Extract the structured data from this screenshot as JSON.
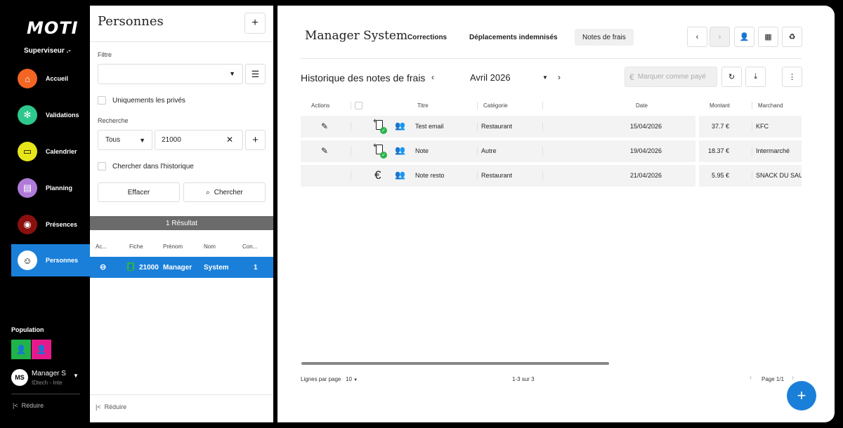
{
  "app": {
    "logo": "MOTI",
    "role": "Superviseur .-"
  },
  "sidebar": {
    "items": [
      {
        "label": "Accueil",
        "color": "#f26522",
        "icon": "home-icon",
        "glyph": "⌂"
      },
      {
        "label": "Validations",
        "color": "#2dc88c",
        "icon": "asterisk-icon",
        "glyph": "✻"
      },
      {
        "label": "Calendrier",
        "color": "#e6e61a",
        "icon": "calendar-icon",
        "glyph": "▭"
      },
      {
        "label": "Planning",
        "color": "#b07ad8",
        "icon": "planning-icon",
        "glyph": "▤"
      },
      {
        "label": "Présences",
        "color": "#8a1010",
        "icon": "eye-icon",
        "glyph": "◉"
      },
      {
        "label": "Personnes",
        "color": "#ffffff",
        "icon": "face-icon",
        "glyph": "☺"
      }
    ],
    "active_index": 5,
    "population_label": "Population",
    "population_colors": [
      "#1fb34a",
      "#e6198c"
    ],
    "user_initials": "MS",
    "user_name": "Manager S",
    "user_sub": "IDtech - Inte",
    "reduce_label": "Réduire"
  },
  "persons": {
    "title": "Personnes",
    "filter_label": "Filtre",
    "filter_value": "",
    "only_private_label": "Uniquements les privés",
    "search_label": "Recherche",
    "scope_value": "Tous",
    "search_value": "21000",
    "history_label": "Chercher dans l'historique",
    "clear_label": "Effacer",
    "search_button_label": "Chercher",
    "result_label": "1 Résultat",
    "columns": [
      "Ac...",
      "Fiche",
      "Prénom",
      "Nom",
      "Con..."
    ],
    "row": {
      "fiche": "21000",
      "prenom": "Manager",
      "nom": "System",
      "con": "1"
    },
    "reduce_label": "Réduire"
  },
  "main": {
    "title": "Manager System",
    "tabs": [
      "Corrections",
      "Déplacements indemnisés",
      "Notes de frais"
    ],
    "active_tab": 2,
    "history_title": "Historique des notes de frais",
    "month": "Avril 2026",
    "mark_paid_label": "Marquer comme payé",
    "columns": {
      "actions": "Actions",
      "titre": "Titre",
      "categorie": "Catégorie",
      "date": "Date",
      "montant": "Montant",
      "marchand": "Marchand"
    },
    "rows": [
      {
        "editable": true,
        "type": "doc",
        "titre": "Test email",
        "categorie": "Restaurant",
        "date": "15/04/2026",
        "montant": "37.7 €",
        "marchand": "KFC"
      },
      {
        "editable": true,
        "type": "doc",
        "titre": "Note",
        "categorie": "Autre",
        "date": "19/04/2026",
        "montant": "18.37 €",
        "marchand": "Intermarché"
      },
      {
        "editable": false,
        "type": "euro",
        "titre": "Note resto",
        "categorie": "Restaurant",
        "date": "21/04/2026",
        "montant": "5.95 €",
        "marchand": "SNACK DU SAUS"
      }
    ],
    "rows_per_page_label": "Lignes par page",
    "rows_per_page_value": "10",
    "range_label": "1-3 sur 3",
    "page_label": "Page 1/1",
    "accent_color": "#1a7fd9"
  }
}
